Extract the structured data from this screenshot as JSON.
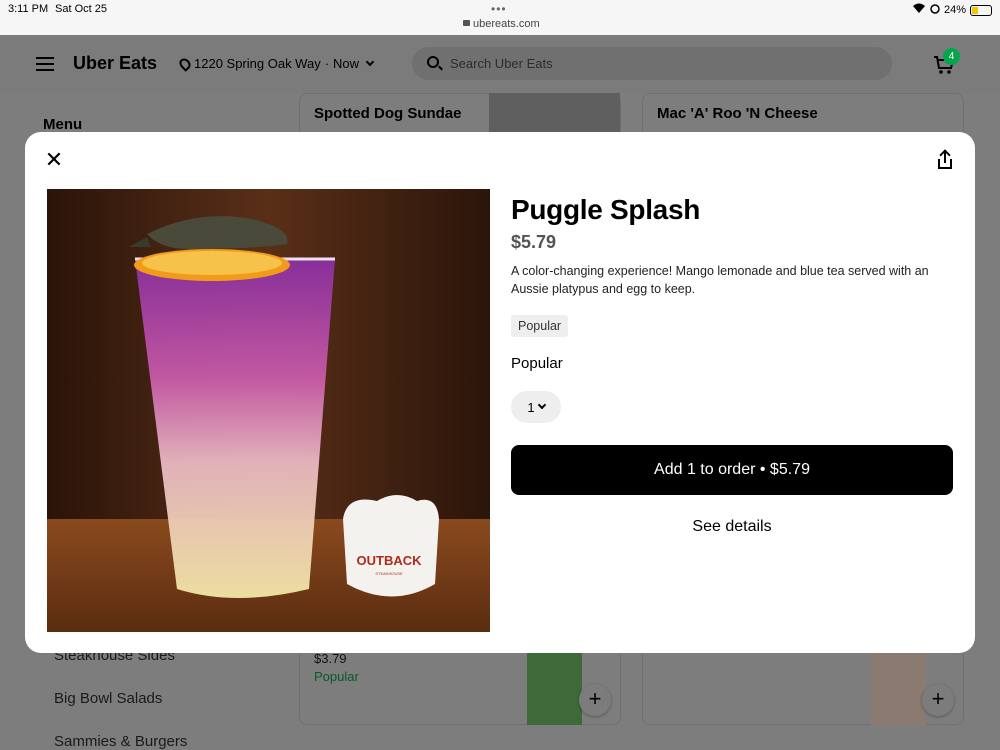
{
  "status_bar": {
    "time": "3:11 PM",
    "date": "Sat Oct 25",
    "dots": "•••",
    "url": "ubereats.com",
    "battery": "24%"
  },
  "header": {
    "logo": "Uber Eats",
    "address": "1220 Spring Oak Way",
    "delivery_time": "Now",
    "search_placeholder": "Search Uber Eats",
    "cart_count": "4"
  },
  "background": {
    "menu_label": "Menu",
    "card_titles": [
      "Spotted Dog Sundae",
      "Mac 'A' Roo 'N Cheese"
    ],
    "sidebar_items": [
      "Steakhouse Sides",
      "Big Bowl Salads",
      "Sammies & Burgers"
    ],
    "card_price": "$3.79",
    "card_tag": "Popular"
  },
  "modal": {
    "title": "Puggle Splash",
    "price": "$5.79",
    "description": "A color-changing experience! Mango lemonade and blue tea served with an Aussie platypus and egg to keep.",
    "tag": "Popular",
    "section_label": "Popular",
    "quantity": "1",
    "add_button": "Add 1 to order • $5.79",
    "details_button": "See details",
    "photo_text": "OUTBACK",
    "photo_subtext": "STEAKHOUSE"
  }
}
